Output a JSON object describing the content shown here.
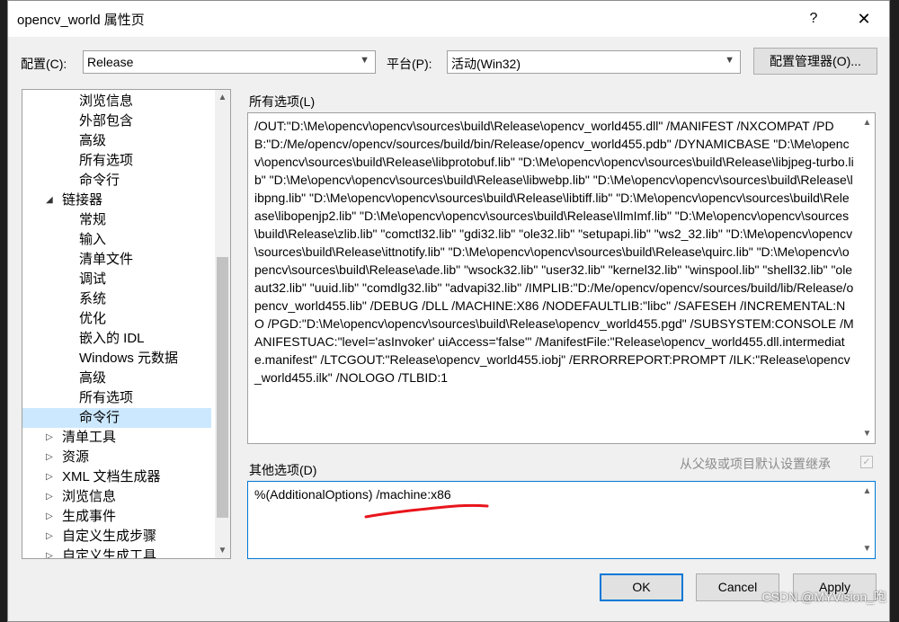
{
  "window": {
    "title": "opencv_world 属性页",
    "help": "?",
    "close": "✕"
  },
  "config": {
    "label": "配置(C):",
    "value": "Release",
    "platform_label": "平台(P):",
    "platform_value": "活动(Win32)",
    "manager_button": "配置管理器(O)..."
  },
  "tree": {
    "items": [
      {
        "label": "浏览信息",
        "indent": 2
      },
      {
        "label": "外部包含",
        "indent": 2
      },
      {
        "label": "高级",
        "indent": 2
      },
      {
        "label": "所有选项",
        "indent": 2
      },
      {
        "label": "命令行",
        "indent": 2
      },
      {
        "label": "链接器",
        "indent": 1,
        "arrow": "expanded"
      },
      {
        "label": "常规",
        "indent": 2
      },
      {
        "label": "输入",
        "indent": 2
      },
      {
        "label": "清单文件",
        "indent": 2
      },
      {
        "label": "调试",
        "indent": 2
      },
      {
        "label": "系统",
        "indent": 2
      },
      {
        "label": "优化",
        "indent": 2
      },
      {
        "label": "嵌入的 IDL",
        "indent": 2
      },
      {
        "label": "Windows 元数据",
        "indent": 2
      },
      {
        "label": "高级",
        "indent": 2
      },
      {
        "label": "所有选项",
        "indent": 2
      },
      {
        "label": "命令行",
        "indent": 2,
        "selected": true
      },
      {
        "label": "清单工具",
        "indent": 1,
        "arrow": "collapsed"
      },
      {
        "label": "资源",
        "indent": 1,
        "arrow": "collapsed"
      },
      {
        "label": "XML 文档生成器",
        "indent": 1,
        "arrow": "collapsed"
      },
      {
        "label": "浏览信息",
        "indent": 1,
        "arrow": "collapsed"
      },
      {
        "label": "生成事件",
        "indent": 1,
        "arrow": "collapsed"
      },
      {
        "label": "自定义生成步骤",
        "indent": 1,
        "arrow": "collapsed"
      },
      {
        "label": "自定义生成工具",
        "indent": 1,
        "arrow": "collapsed"
      }
    ]
  },
  "all_options": {
    "label": "所有选项(L)",
    "text": "/OUT:\"D:\\Me\\opencv\\opencv\\sources\\build\\Release\\opencv_world455.dll\" /MANIFEST /NXCOMPAT /PDB:\"D:/Me/opencv/opencv/sources/build/bin/Release/opencv_world455.pdb\" /DYNAMICBASE \"D:\\Me\\opencv\\opencv\\sources\\build\\Release\\libprotobuf.lib\" \"D:\\Me\\opencv\\opencv\\sources\\build\\Release\\libjpeg-turbo.lib\" \"D:\\Me\\opencv\\opencv\\sources\\build\\Release\\libwebp.lib\" \"D:\\Me\\opencv\\opencv\\sources\\build\\Release\\libpng.lib\" \"D:\\Me\\opencv\\opencv\\sources\\build\\Release\\libtiff.lib\" \"D:\\Me\\opencv\\opencv\\sources\\build\\Release\\libopenjp2.lib\" \"D:\\Me\\opencv\\opencv\\sources\\build\\Release\\IlmImf.lib\" \"D:\\Me\\opencv\\opencv\\sources\\build\\Release\\zlib.lib\" \"comctl32.lib\" \"gdi32.lib\" \"ole32.lib\" \"setupapi.lib\" \"ws2_32.lib\" \"D:\\Me\\opencv\\opencv\\sources\\build\\Release\\ittnotify.lib\" \"D:\\Me\\opencv\\opencv\\sources\\build\\Release\\quirc.lib\" \"D:\\Me\\opencv\\opencv\\sources\\build\\Release\\ade.lib\" \"wsock32.lib\" \"user32.lib\" \"kernel32.lib\" \"winspool.lib\" \"shell32.lib\" \"oleaut32.lib\" \"uuid.lib\" \"comdlg32.lib\" \"advapi32.lib\" /IMPLIB:\"D:/Me/opencv/opencv/sources/build/lib/Release/opencv_world455.lib\" /DEBUG /DLL /MACHINE:X86 /NODEFAULTLIB:\"libc\" /SAFESEH /INCREMENTAL:NO /PGD:\"D:\\Me\\opencv\\opencv\\sources\\build\\Release\\opencv_world455.pgd\" /SUBSYSTEM:CONSOLE /MANIFESTUAC:\"level='asInvoker' uiAccess='false'\" /ManifestFile:\"Release\\opencv_world455.dll.intermediate.manifest\" /LTCGOUT:\"Release\\opencv_world455.iobj\" /ERRORREPORT:PROMPT /ILK:\"Release\\opencv_world455.ilk\" /NOLOGO /TLBID:1"
  },
  "other_options": {
    "label": "其他选项(D)",
    "inherit_label": "从父级或项目默认设置继承",
    "inherit_checked": true,
    "value": "%(AdditionalOptions) /machine:x86"
  },
  "buttons": {
    "ok": "OK",
    "cancel": "Cancel",
    "apply": "Apply"
  },
  "watermark": "CSDN @MYVision_咆",
  "colors": {
    "accent": "#0078d7",
    "selection": "#cce8ff",
    "annotation": "#e8151b"
  }
}
